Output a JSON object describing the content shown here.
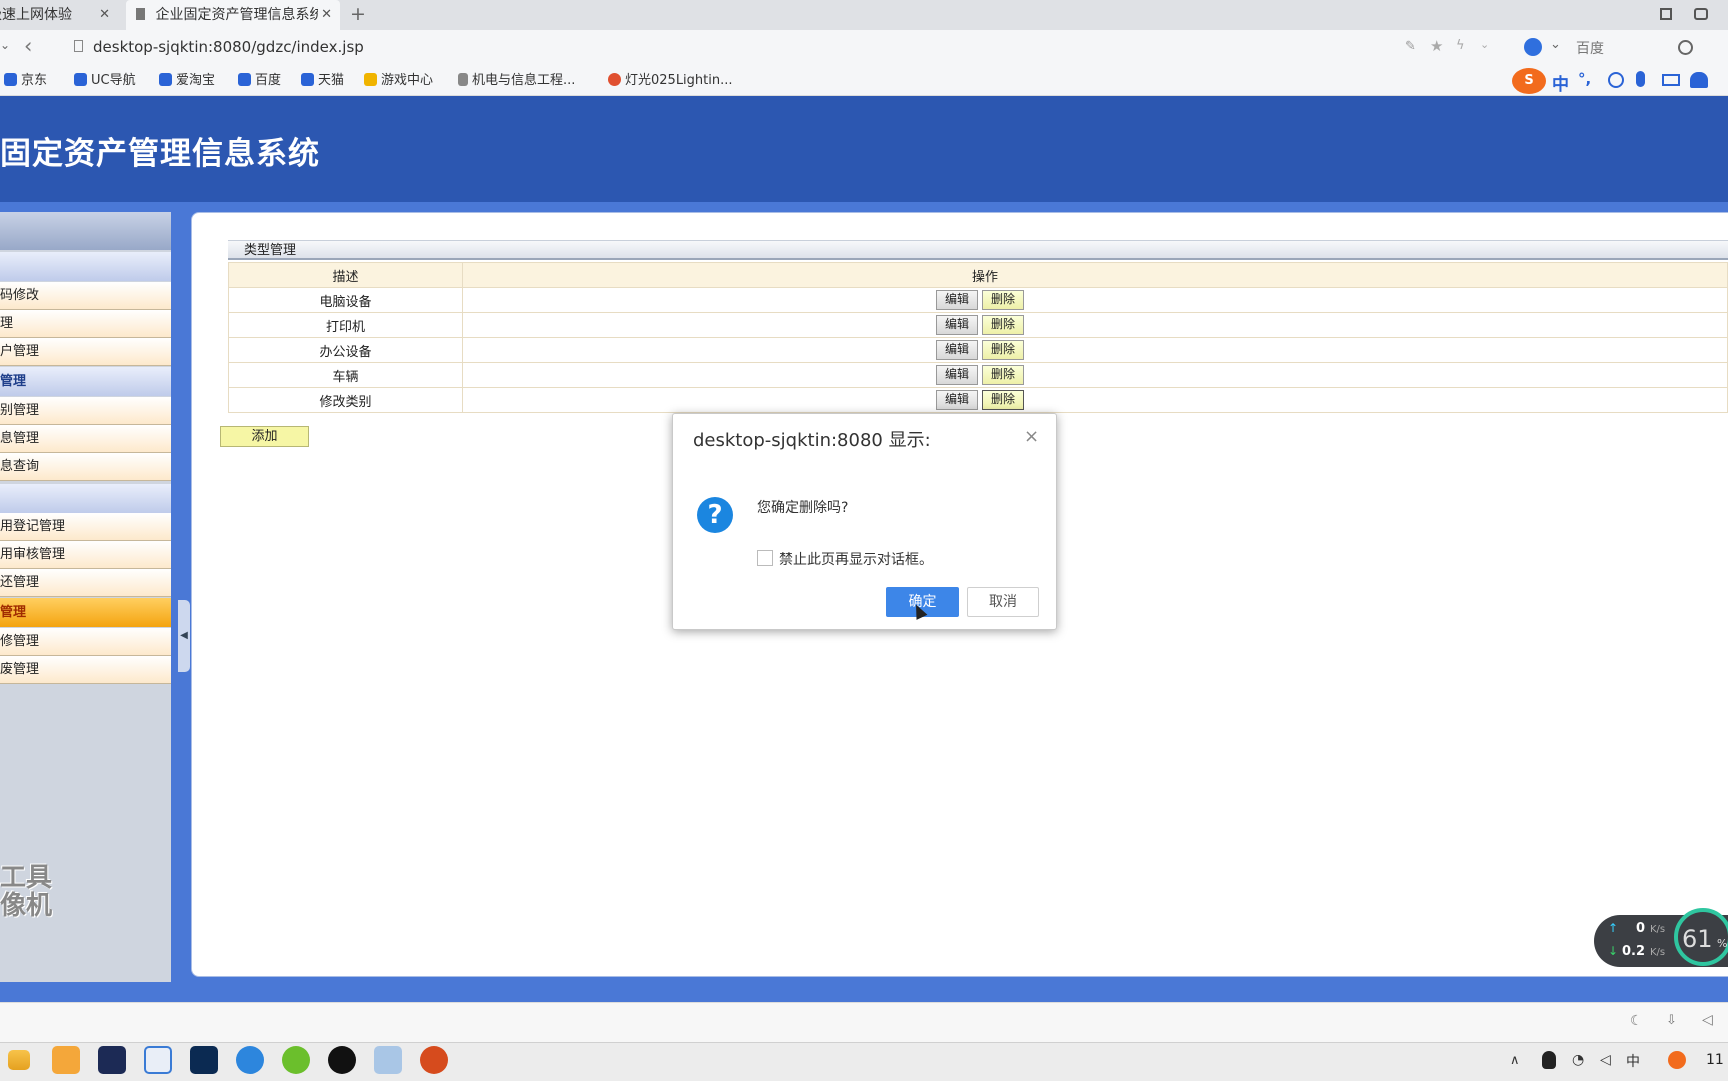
{
  "browser": {
    "tabs": [
      {
        "label": "极速上网体验",
        "active": false
      },
      {
        "label": "企业固定资产管理信息系统",
        "active": true
      }
    ],
    "new_tab": "+",
    "url": "desktop-sjqktin:8080/gdzc/index.jsp",
    "search_engine": "百度",
    "bookmarks": [
      "京东",
      "UC导航",
      "爱淘宝",
      "百度",
      "天猫",
      "游戏中心",
      "机电与信息工程...",
      "灯光025Lightin..."
    ],
    "ime": {
      "mode": "中",
      "punct": "°,"
    }
  },
  "app": {
    "title": "固定资产管理信息系统"
  },
  "sidebar": {
    "items": [
      {
        "label": "",
        "type": "group"
      },
      {
        "label": "码修改",
        "type": "item"
      },
      {
        "label": "理",
        "type": "item"
      },
      {
        "label": "户管理",
        "type": "item"
      },
      {
        "label": "管理",
        "type": "group"
      },
      {
        "label": "别管理",
        "type": "item"
      },
      {
        "label": "息管理",
        "type": "item"
      },
      {
        "label": "息查询",
        "type": "item"
      },
      {
        "label": "",
        "type": "group"
      },
      {
        "label": "用登记管理",
        "type": "item"
      },
      {
        "label": "用审核管理",
        "type": "item"
      },
      {
        "label": "还管理",
        "type": "item"
      },
      {
        "label": "管理",
        "type": "group-active"
      },
      {
        "label": "修管理",
        "type": "item"
      },
      {
        "label": "废管理",
        "type": "item"
      }
    ]
  },
  "panel": {
    "title": "类型管理",
    "columns": [
      "描述",
      "操作"
    ],
    "rows": [
      {
        "name": "电脑设备"
      },
      {
        "name": "打印机"
      },
      {
        "name": "办公设备"
      },
      {
        "name": "车辆"
      },
      {
        "name": "修改类别"
      }
    ],
    "edit_label": "编辑",
    "delete_label": "删除",
    "add_label": "添加"
  },
  "dialog": {
    "title": "desktop-sjqktin:8080 显示:",
    "close": "×",
    "message": "您确定删除吗?",
    "checkbox_label": "禁止此页再显示对话框。",
    "ok_label": "确定",
    "cancel_label": "取消"
  },
  "watermark": {
    "line1": "工具",
    "line2": "像机"
  },
  "network": {
    "up": "0",
    "down": "0.2",
    "unit": "K/s",
    "percent": "61",
    "percent_suffix": "%"
  },
  "taskbar": {
    "clock": "11"
  },
  "colors": {
    "header": "#2c57b1",
    "accent": "#3d86e8",
    "active_group": "#f4a410"
  }
}
